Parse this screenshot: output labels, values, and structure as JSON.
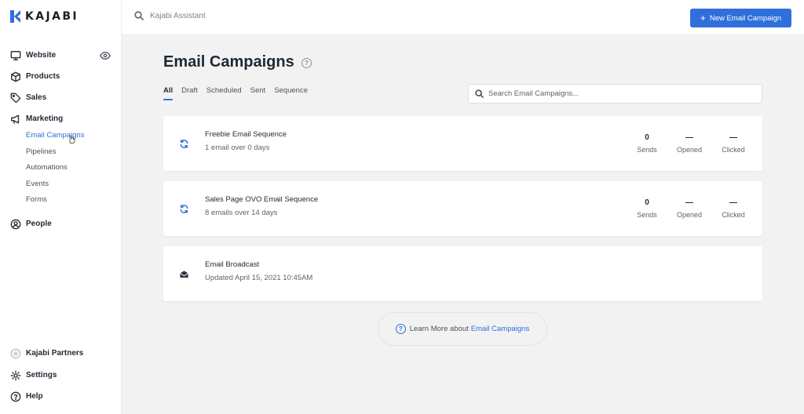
{
  "brand": {
    "name": "KAJABI",
    "accent": "#2f6fdb"
  },
  "sidebar": {
    "website": "Website",
    "products": "Products",
    "sales": "Sales",
    "marketing": "Marketing",
    "marketing_sub": [
      "Email Campaigns",
      "Pipelines",
      "Automations",
      "Events",
      "Forms"
    ],
    "people": "People",
    "partners": "Kajabi Partners",
    "settings": "Settings",
    "help": "Help"
  },
  "topbar": {
    "search_placeholder": "Kajabi Assistant",
    "new_button": "New Email Campaign"
  },
  "main": {
    "title": "Email Campaigns",
    "tabs": [
      "All",
      "Draft",
      "Scheduled",
      "Sent",
      "Sequence"
    ],
    "active_tab": "All",
    "search_placeholder": "Search Email Campaigns...",
    "campaigns": [
      {
        "title": "Freebie Email Sequence",
        "subtitle": "1 email over 0 days",
        "icon": "sequence-icon",
        "sends": "0",
        "opened": "—",
        "clicked": "—"
      },
      {
        "title": "Sales Page OVO Email Sequence",
        "subtitle": "8 emails over 14 days",
        "icon": "sequence-icon",
        "sends": "0",
        "opened": "—",
        "clicked": "—"
      },
      {
        "title": "Email Broadcast",
        "subtitle": "Updated April 15, 2021 10:45AM",
        "icon": "broadcast-icon"
      }
    ],
    "stat_labels": {
      "sends": "Sends",
      "opened": "Opened",
      "clicked": "Clicked"
    },
    "learn_prefix": "Learn More about",
    "learn_link": "Email Campaigns"
  }
}
